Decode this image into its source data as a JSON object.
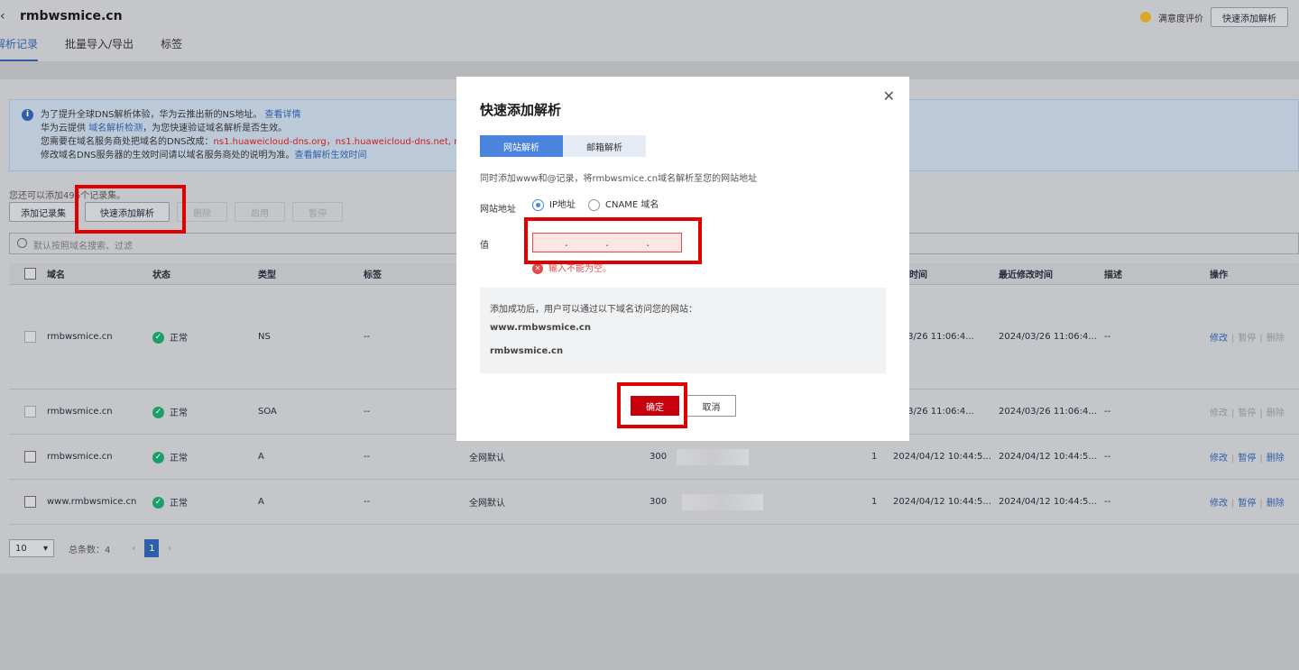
{
  "header": {
    "back_glyph": "‹",
    "title": "rmbwsmice.cn",
    "tabs": [
      "解析记录",
      "批量导入/导出",
      "标签"
    ],
    "satisfaction": "满意度评价",
    "quick_add_button": "快速添加解析"
  },
  "notice": {
    "line1": "为了提升全球DNS解析体验，华为云推出新的NS地址。",
    "line1_link": "查看详情",
    "line2_pre": "华为云提供",
    "line2_link": "域名解析检测",
    "line2_post": "，为您快速验证域名解析是否生效。",
    "line3_pre": "您需要在域名服务商处把域名的DNS改成：",
    "line3_ns": "ns1.huaweicloud-dns.org，ns1.huaweicloud-dns.net, ns1.hu",
    "line4_pre": "修改域名DNS服务器的生效时间请以域名服务商处的说明为准。",
    "line4_link": "查看解析生效时间"
  },
  "toolbar": {
    "quota": "您还可以添加496个记录集。",
    "add_record": "添加记录集",
    "quick_add": "快速添加解析",
    "delete": "删除",
    "enable": "启用",
    "pause": "暂停"
  },
  "search": {
    "placeholder": "默认按照域名搜索、过滤"
  },
  "table": {
    "headers": {
      "domain": "域名",
      "status": "状态",
      "type": "类型",
      "tag": "标签",
      "created": "时间",
      "modified": "最近修改时间",
      "desc": "描述",
      "ops": "操作"
    },
    "rows": [
      {
        "domain": "rmbwsmice.cn",
        "status": "正常",
        "type": "NS",
        "tag": "--",
        "line": "",
        "ttl": "",
        "weight": "",
        "created": "4/03/26 11:06:4...",
        "modified": "2024/03/26 11:06:4...",
        "desc": "--",
        "op_edit": "修改",
        "op_pause": "暂停",
        "op_delete": "删除"
      },
      {
        "domain": "rmbwsmice.cn",
        "status": "正常",
        "type": "SOA",
        "tag": "--",
        "line": "",
        "ttl": "",
        "weight": "",
        "created": "4/03/26 11:06:4...",
        "modified": "2024/03/26 11:06:4...",
        "desc": "--",
        "op_edit": "修改",
        "op_pause": "暂停",
        "op_delete": "删除"
      },
      {
        "domain": "rmbwsmice.cn",
        "status": "正常",
        "type": "A",
        "tag": "--",
        "line": "全网默认",
        "ttl": "300",
        "weight": "1",
        "created": "2024/04/12 10:44:5...",
        "modified": "2024/04/12 10:44:5...",
        "desc": "--",
        "op_edit": "修改",
        "op_pause": "暂停",
        "op_delete": "删除"
      },
      {
        "domain": "www.rmbwsmice.cn",
        "status": "正常",
        "type": "A",
        "tag": "--",
        "line": "全网默认",
        "ttl": "300",
        "weight": "1",
        "created": "2024/04/12 10:44:5...",
        "modified": "2024/04/12 10:44:5...",
        "desc": "--",
        "op_edit": "修改",
        "op_pause": "暂停",
        "op_delete": "删除"
      }
    ]
  },
  "pager": {
    "page_size": "10",
    "total": "总条数：4",
    "current": "1"
  },
  "dialog": {
    "title": "快速添加解析",
    "tab_site": "网站解析",
    "tab_mail": "邮箱解析",
    "description": "同时添加www和@记录，将rmbwsmice.cn域名解析至您的网站地址",
    "address_label": "网站地址",
    "opt_ip": "IP地址",
    "opt_cname": "CNAME 域名",
    "value_label": "值",
    "error": "输入不能为空。",
    "result_intro": "添加成功后，用户可以通过以下域名访问您的网站：",
    "result_www": "www.rmbwsmice.cn",
    "result_root": "rmbwsmice.cn",
    "confirm": "确定",
    "cancel": "取消"
  }
}
